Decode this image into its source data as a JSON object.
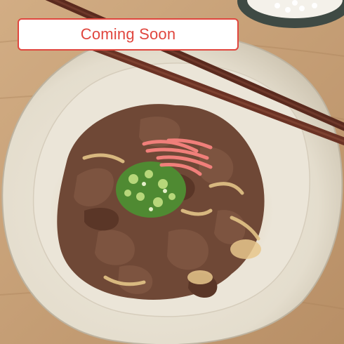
{
  "banner": {
    "label": "Coming Soon",
    "color": "#e0463e"
  },
  "photo": {
    "subject": "food-photo",
    "colors": {
      "table": "#c8a47c",
      "plate": "#e9e3d6",
      "meat": "#6a4532",
      "ginger": "#f07f7a",
      "scallion": "#5f9e3c",
      "chopsticks": "#5a2a1e"
    }
  }
}
